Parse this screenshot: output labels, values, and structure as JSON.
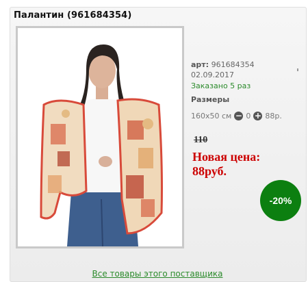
{
  "product": {
    "title": "Палантин (961684354)",
    "art_label": "арт:",
    "art_value": "961684354",
    "date": "02.09.2017",
    "ordered": "Заказано 5 раз",
    "sizes_label": "Размеры",
    "size": "160х50 см",
    "quantity": "0",
    "size_price": "88р.",
    "old_price": "110",
    "new_price_label": "Новая цена:",
    "new_price_value": "88руб.",
    "discount": "-20%",
    "supplier_link": "Все товары этого поставщика"
  },
  "icons": {
    "minus": "minus-circle-icon",
    "plus": "plus-circle-icon"
  },
  "colors": {
    "discount_bg": "#0c7f10",
    "new_price": "#cc0000",
    "ordered": "#2b8a2b"
  }
}
